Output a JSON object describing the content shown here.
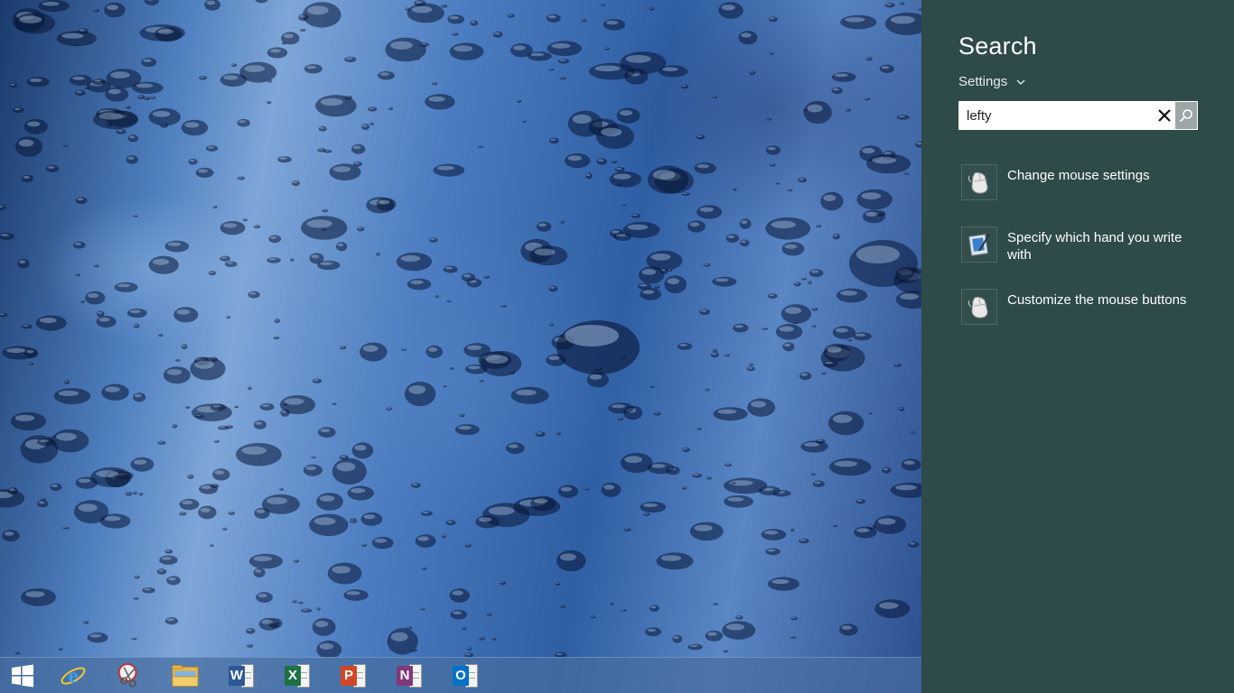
{
  "taskbar": {
    "items": [
      {
        "name": "start-button",
        "icon": "windows-logo-icon"
      },
      {
        "name": "internet-explorer",
        "icon": "internet-explorer-icon"
      },
      {
        "name": "snipping-tool",
        "icon": "snipping-tool-icon"
      },
      {
        "name": "file-explorer",
        "icon": "folder-icon"
      },
      {
        "name": "word",
        "icon": "word-icon",
        "letter": "W",
        "color": "#2b5797"
      },
      {
        "name": "excel",
        "icon": "excel-icon",
        "letter": "X",
        "color": "#1e7145"
      },
      {
        "name": "powerpoint",
        "icon": "powerpoint-icon",
        "letter": "P",
        "color": "#d24726"
      },
      {
        "name": "onenote",
        "icon": "onenote-icon",
        "letter": "N",
        "color": "#80397b"
      },
      {
        "name": "outlook",
        "icon": "outlook-icon",
        "letter": "O",
        "color": "#0072c6"
      }
    ]
  },
  "search_pane": {
    "title": "Search",
    "scope": "Settings",
    "query": "lefty",
    "results": [
      {
        "label": "Change mouse settings",
        "icon": "mouse-icon"
      },
      {
        "label": "Specify which hand you write with",
        "icon": "tablet-pen-icon"
      },
      {
        "label": "Customize the mouse buttons",
        "icon": "mouse-icon"
      }
    ]
  },
  "colors": {
    "pane_background": "#2e4a49",
    "search_button": "#9da7a8",
    "taskbar": "#466ea0"
  }
}
